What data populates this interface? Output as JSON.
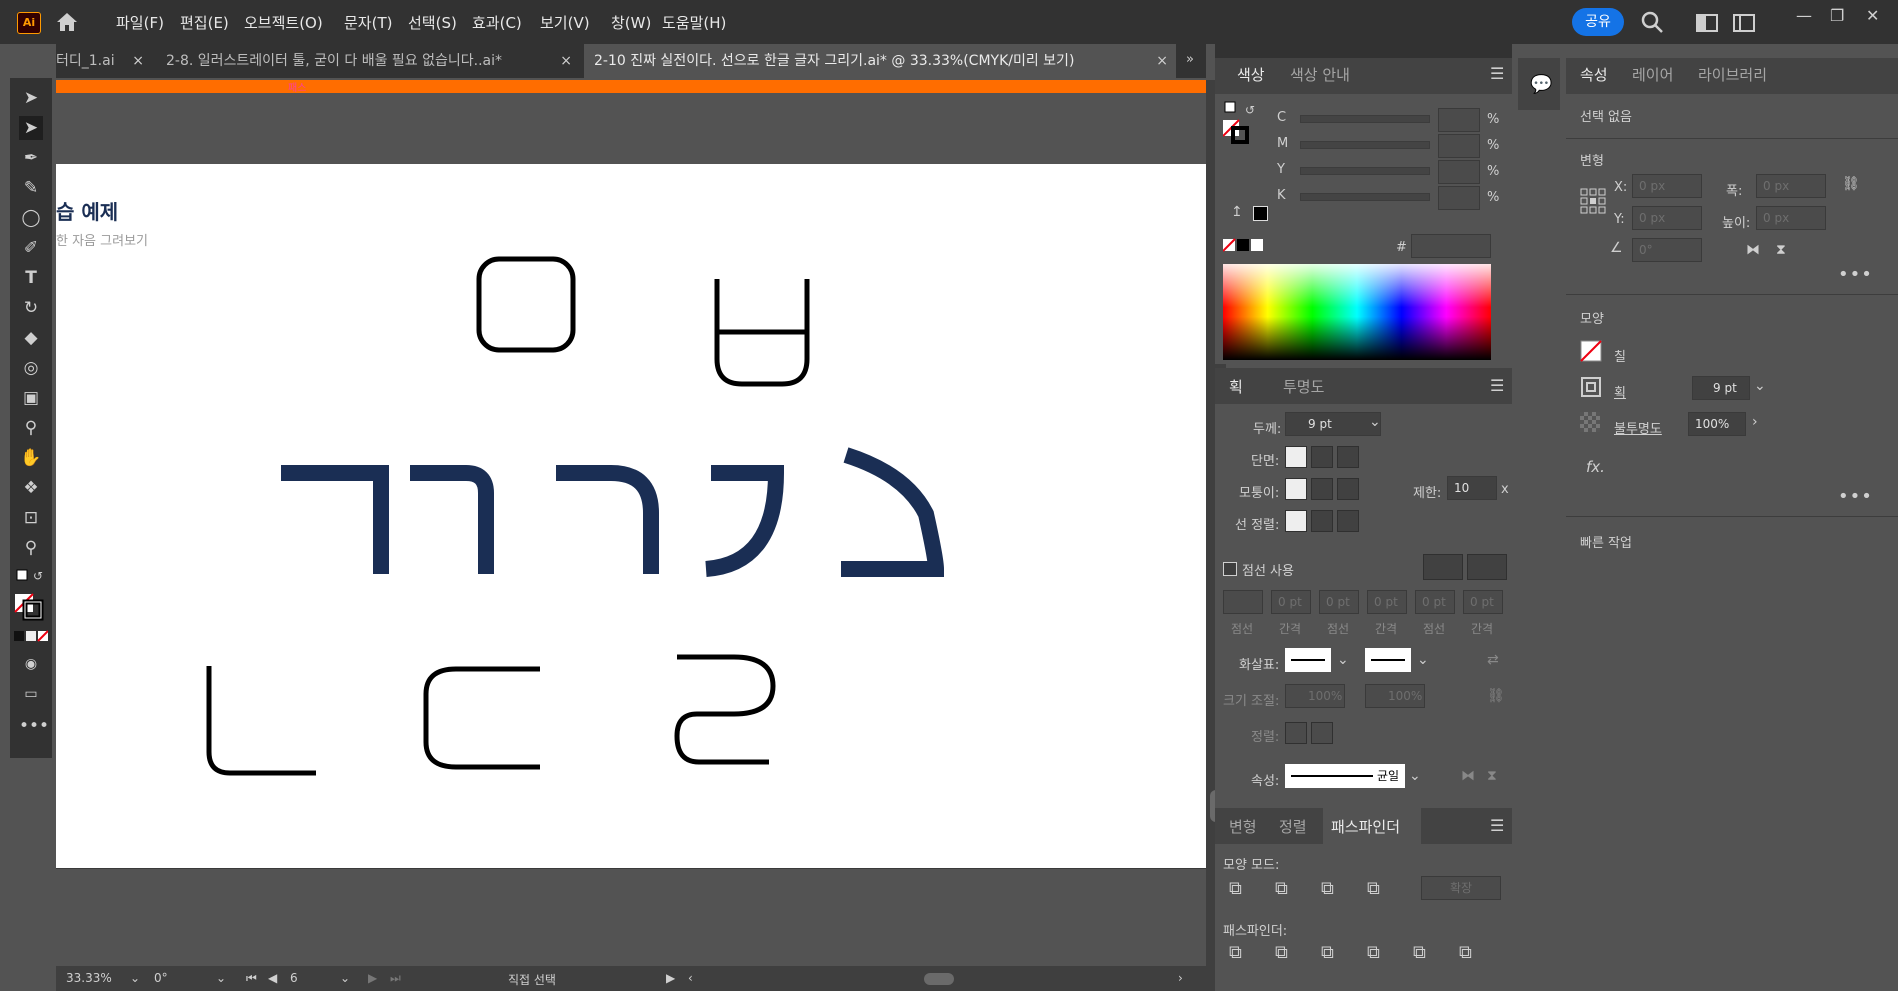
{
  "menubar": {
    "items": [
      "파일(F)",
      "편집(E)",
      "오브젝트(O)",
      "문자(T)",
      "선택(S)",
      "효과(C)",
      "보기(V)",
      "창(W)",
      "도움말(H)"
    ],
    "share_label": "공유",
    "app_logo": "Ai"
  },
  "tabs": [
    {
      "label": "터디_1.ai"
    },
    {
      "label": "2-8. 일러스트레이터 툴, 굳이 다 배울 필요 없습니다..ai*"
    },
    {
      "label": "2-10 진짜 실전이다. 선으로 한글 글자 그리기.ai* @ 33.33%(CMYK/미리 보기)"
    }
  ],
  "canvas": {
    "path_label": "패스",
    "art_title": "습 예제",
    "art_subtitle": "한 자음 그려보기"
  },
  "statusbar": {
    "zoom": "33.33%",
    "rotation": "0°",
    "artboard_num": "6",
    "tool_name": "직접 선택"
  },
  "color_panel": {
    "tab_color": "색상",
    "tab_guide": "색상 안내",
    "channels": [
      "C",
      "M",
      "Y",
      "K"
    ],
    "percent": "%",
    "hash": "#"
  },
  "stroke_panel": {
    "tab_stroke": "획",
    "tab_transparency": "투명도",
    "weight_label": "두께:",
    "weight_value": "9 pt",
    "cap_label": "단면:",
    "corner_label": "모퉁이:",
    "limit_label": "제한:",
    "limit_value": "10",
    "limit_x": "x",
    "align_label": "선 정렬:",
    "dashed_label": "점선 사용",
    "dash_values": [
      "0 pt",
      "0 pt",
      "0 pt",
      "0 pt",
      "0 pt",
      "0 pt"
    ],
    "dash_labels": [
      "점선",
      "간격",
      "점선",
      "간격",
      "점선",
      "간격"
    ],
    "arrow_label": "화살표:",
    "scale_label": "크기 조절:",
    "scale_values": [
      "100%",
      "100%"
    ],
    "arrow_align_label": "정렬:",
    "profile_label": "속성:",
    "profile_value": "균일"
  },
  "pathfinder_panel": {
    "tab_transform": "변형",
    "tab_align": "정렬",
    "tab_pathfinder": "패스파인더",
    "shape_modes_label": "모양 모드:",
    "expand_label": "확장",
    "pathfinders_label": "패스파인더:"
  },
  "properties_panel": {
    "tab_properties": "속성",
    "tab_layers": "레이어",
    "tab_libraries": "라이브러리",
    "selection": "선택 없음",
    "transform_header": "변형",
    "x_label": "X:",
    "y_label": "Y:",
    "w_label": "폭:",
    "h_label": "높이:",
    "x_value": "0 px",
    "y_value": "0 px",
    "w_value": "0 px",
    "h_value": "0 px",
    "angle_value": "0°",
    "appearance_header": "모양",
    "fill_label": "칠",
    "stroke_label": "획",
    "stroke_value": "9 pt",
    "opacity_label": "불투명도",
    "opacity_value": "100%",
    "fx_label": "fx.",
    "quick_actions": "빠른 작업"
  },
  "colors": {
    "accent": "#1473e6",
    "orange": "#ff6d00",
    "navy": "#1a2e54"
  }
}
